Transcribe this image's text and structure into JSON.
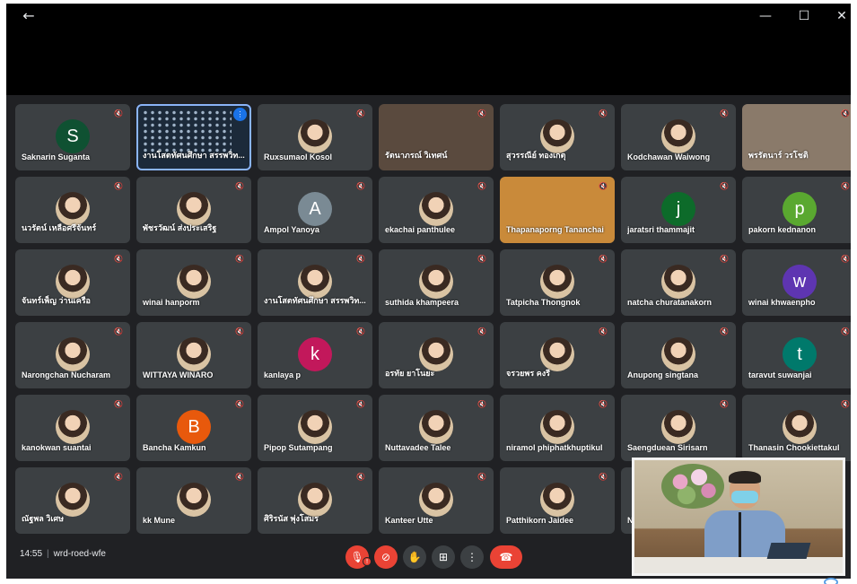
{
  "window": {
    "back": "←",
    "minimize": "—",
    "maximize": "☐",
    "close": "✕"
  },
  "tiles": [
    {
      "name": "Saknarin Suganta",
      "initial": "S",
      "color": "#0f5132"
    },
    {
      "name": "งานโสตทัศนศึกษา สรรพวิท...",
      "speaking": true
    },
    {
      "name": "Ruxsumaol Kosol",
      "photo": true
    },
    {
      "name": "รัตนาภรณ์ วิเทศน์",
      "video": "v1"
    },
    {
      "name": "สุวรรณีย์ ทองเกตุ",
      "photo": true
    },
    {
      "name": "Kodchawan Waiwong",
      "photo": true
    },
    {
      "name": "พรรัตนาร์ วรโชติ",
      "video": "v2"
    },
    {
      "name": "นวรัตน์ เหลือศรีจันทร์",
      "photo": true
    },
    {
      "name": "พัชรวัฒน์ ส่งประเสริฐ",
      "photo": true
    },
    {
      "name": "Ampol Yanoya",
      "initial": "A",
      "color": "#7a8a94"
    },
    {
      "name": "ekachai panthulee",
      "photo": true
    },
    {
      "name": "Thapanaporng Tananchai",
      "video": "v3"
    },
    {
      "name": "jaratsri thammajit",
      "initial": "j",
      "color": "#0d6b2a"
    },
    {
      "name": "pakorn kednanon",
      "initial": "p",
      "color": "#5aa830"
    },
    {
      "name": "จันทร์เพ็ญ ว่านเครือ",
      "photo": true
    },
    {
      "name": "winai hanporm",
      "photo": true
    },
    {
      "name": "งานโสตทัศนศึกษา สรรพวิท...",
      "photo": true
    },
    {
      "name": "suthida khampeera",
      "photo": true
    },
    {
      "name": "Tatpicha Thongnok",
      "photo": true
    },
    {
      "name": "natcha churatanakorn",
      "photo": true
    },
    {
      "name": "winai khwaenpho",
      "initial": "w",
      "color": "#5e35b1"
    },
    {
      "name": "Narongchan Nucharam",
      "photo": true
    },
    {
      "name": "WITTAYA WINARO",
      "photo": true
    },
    {
      "name": "kanlaya p",
      "initial": "k",
      "color": "#c2185b"
    },
    {
      "name": "อรทัย ยาโนยะ",
      "photo": true
    },
    {
      "name": "จรวยพร คงรี",
      "photo": true
    },
    {
      "name": "Anupong singtana",
      "photo": true
    },
    {
      "name": "taravut suwanjai",
      "initial": "t",
      "color": "#00796b"
    },
    {
      "name": "kanokwan suantai",
      "photo": true
    },
    {
      "name": "Bancha Kamkun",
      "initial": "B",
      "color": "#e8590c"
    },
    {
      "name": "Pipop Sutampang",
      "photo": true
    },
    {
      "name": "Nuttavadee Talee",
      "photo": true
    },
    {
      "name": "niramol phiphatkhuptikul",
      "photo": true
    },
    {
      "name": "Saengduean Sirisarn",
      "photo": true
    },
    {
      "name": "Thanasin Chookiettakul",
      "photo": true
    },
    {
      "name": "ณัฐพล วิเศษ",
      "photo": true
    },
    {
      "name": "kk Mune",
      "photo": true
    },
    {
      "name": "ศิริรนัส พุ่งโสมร",
      "photo": true
    },
    {
      "name": "Kanteer Utte",
      "photo": true
    },
    {
      "name": "Patthikorn Jaidee",
      "photo": true
    },
    {
      "name": "N",
      "photo": false
    }
  ],
  "bottom": {
    "time": "14:55",
    "separator": "|",
    "meeting_code": "wrd-roed-wfe"
  },
  "controls": {
    "mic_icon": "🎙",
    "camera_icon": "⊘",
    "hand_icon": "✋",
    "present_icon": "⊞",
    "more_icon": "⋮",
    "leave_icon": "☎",
    "alert": "!"
  },
  "colors": {
    "background": "#202124",
    "tile": "#3c4043",
    "danger": "#ea4335",
    "accent": "#1a73e8"
  }
}
